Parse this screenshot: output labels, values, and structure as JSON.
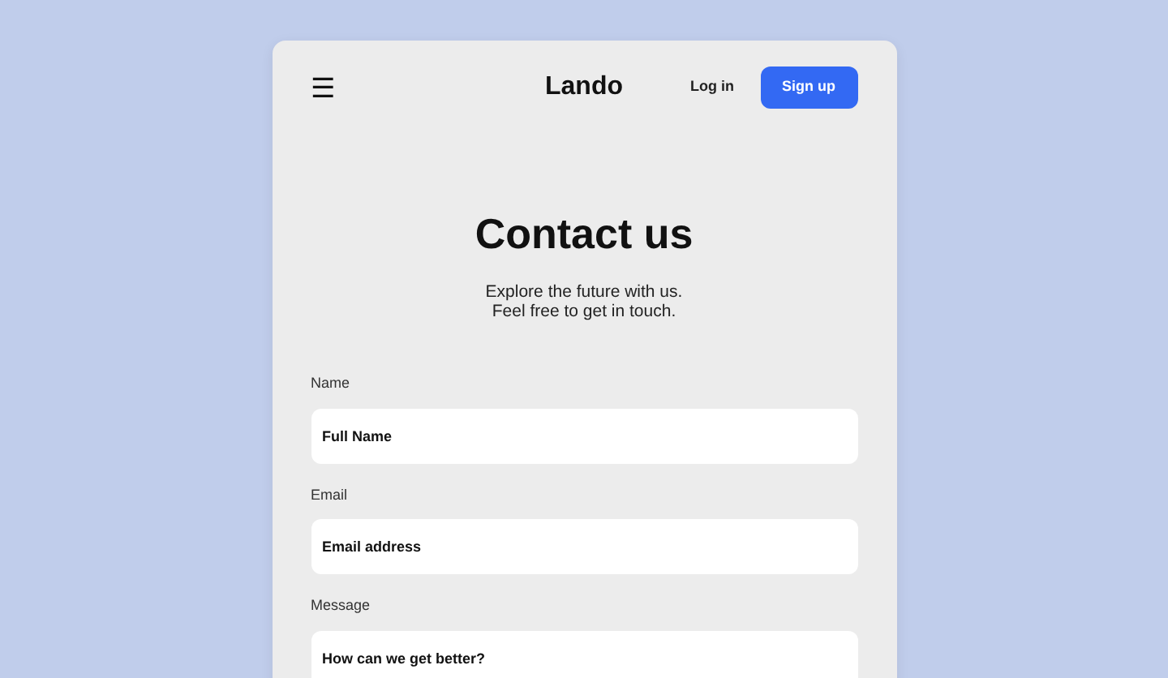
{
  "header": {
    "menu": "☰",
    "brand": "Lando",
    "login": "Log in",
    "signup": "Sign up"
  },
  "hero": {
    "title": "Contact us",
    "lines": [
      "Explore the future with us.",
      "Feel free to get in touch."
    ]
  },
  "fields": [
    {
      "kind": "input",
      "label": "Name",
      "placeholder": "Full Name"
    },
    {
      "kind": "input",
      "label": "Email",
      "placeholder": "Email address"
    },
    {
      "kind": "textarea",
      "label": "Message",
      "placeholder": "How can we get better?"
    }
  ]
}
